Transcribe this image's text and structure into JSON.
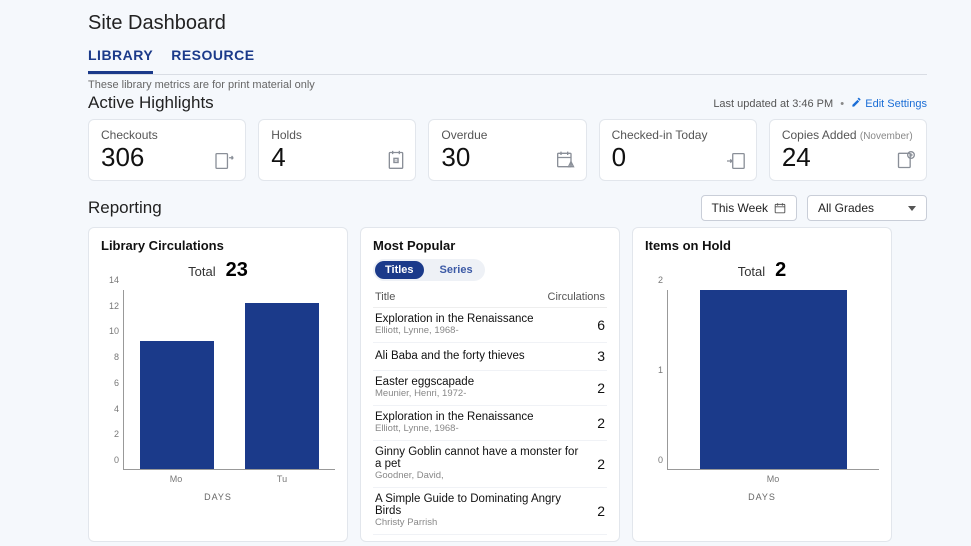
{
  "page_title": "Site Dashboard",
  "tabs": {
    "library": "LIBRARY",
    "resource": "RESOURCE"
  },
  "subnote": "These library metrics are for print material only",
  "highlights_title": "Active Highlights",
  "updated_prefix": "Last updated at ",
  "updated_time": "3:46 PM",
  "edit_label": "Edit Settings",
  "cards": {
    "checkouts": {
      "label": "Checkouts",
      "value": "306"
    },
    "holds": {
      "label": "Holds",
      "value": "4"
    },
    "overdue": {
      "label": "Overdue",
      "value": "30"
    },
    "checkedin": {
      "label": "Checked-in Today",
      "value": "0"
    },
    "copies": {
      "label": "Copies Added ",
      "sub": "(November)",
      "value": "24"
    }
  },
  "reporting_title": "Reporting",
  "controls": {
    "thisweek": "This Week",
    "grades": "All Grades"
  },
  "circ": {
    "title": "Library Circulations",
    "total_label": "Total",
    "total_value": "23",
    "axis": "DAYS"
  },
  "popular": {
    "title": "Most Popular",
    "tab_titles": "Titles",
    "tab_series": "Series",
    "col_title": "Title",
    "col_circ": "Circulations",
    "rows": [
      {
        "title": "Exploration in the Renaissance",
        "author": "Elliott, Lynne, 1968-",
        "count": "6"
      },
      {
        "title": "Ali Baba and the forty thieves",
        "author": "",
        "count": "3"
      },
      {
        "title": "Easter eggscapade",
        "author": "Meunier, Henri, 1972-",
        "count": "2"
      },
      {
        "title": "Exploration in the Renaissance",
        "author": "Elliott, Lynne, 1968-",
        "count": "2"
      },
      {
        "title": "Ginny Goblin cannot have a monster for a pet",
        "author": "Goodner, David,",
        "count": "2"
      },
      {
        "title": "A Simple Guide to Dominating Angry Birds",
        "author": "Christy Parrish",
        "count": "2"
      }
    ]
  },
  "hold": {
    "title": "Items on Hold",
    "total_label": "Total",
    "total_value": "2",
    "axis": "DAYS"
  },
  "chart_data": [
    {
      "type": "bar",
      "title": "Library Circulations",
      "categories": [
        "Mo",
        "Tu"
      ],
      "values": [
        10,
        13
      ],
      "xlabel": "DAYS",
      "ylabel": "",
      "ylim": [
        0,
        14
      ],
      "yticks": [
        0,
        2,
        4,
        6,
        8,
        10,
        12,
        14
      ]
    },
    {
      "type": "bar",
      "title": "Items on Hold",
      "categories": [
        "Mo"
      ],
      "values": [
        2
      ],
      "xlabel": "DAYS",
      "ylabel": "",
      "ylim": [
        0,
        2
      ],
      "yticks": [
        0,
        1,
        2
      ]
    }
  ]
}
